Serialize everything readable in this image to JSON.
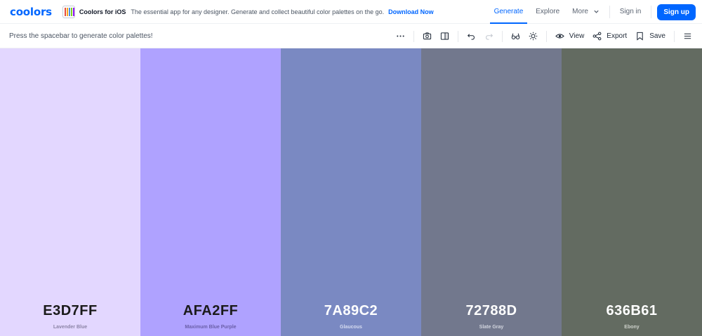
{
  "header": {
    "logo_text": "coolors",
    "ios_promo": {
      "title": "Coolors for iOS",
      "description": "The essential app for any designer. Generate and collect beautiful color palettes on the go.",
      "link": "Download Now"
    },
    "nav": {
      "generate": "Generate",
      "explore": "Explore",
      "more": "More",
      "signin": "Sign in",
      "signup": "Sign up"
    }
  },
  "toolbar": {
    "hint": "Press the spacebar to generate color palettes!",
    "view_label": "View",
    "export_label": "Export",
    "save_label": "Save",
    "icons": [
      "more-dots-icon",
      "camera-icon",
      "sidebar-panel-icon",
      "undo-icon",
      "redo-icon",
      "glasses-icon",
      "sun-icon",
      "eye-icon",
      "share-icon",
      "bookmark-icon",
      "menu-icon"
    ]
  },
  "palette": [
    {
      "hex": "E3D7FF",
      "name": "Lavender Blue",
      "color": "#E3D7FF",
      "text_color": "#1a1a1a",
      "name_color": "#8c84a6"
    },
    {
      "hex": "AFA2FF",
      "name": "Maximum Blue Purple",
      "color": "#AFA2FF",
      "text_color": "#1a1a1a",
      "name_color": "#6a5fa8"
    },
    {
      "hex": "7A89C2",
      "name": "Glaucous",
      "color": "#7A89C2",
      "text_color": "#ffffff",
      "name_color": "#d5dbf0"
    },
    {
      "hex": "72788D",
      "name": "Slate Gray",
      "color": "#72788D",
      "text_color": "#ffffff",
      "name_color": "#d2d5de"
    },
    {
      "hex": "636B61",
      "name": "Ebony",
      "color": "#636B61",
      "text_color": "#ffffff",
      "name_color": "#cdd1cb"
    }
  ],
  "accent_color": "#0066FF"
}
